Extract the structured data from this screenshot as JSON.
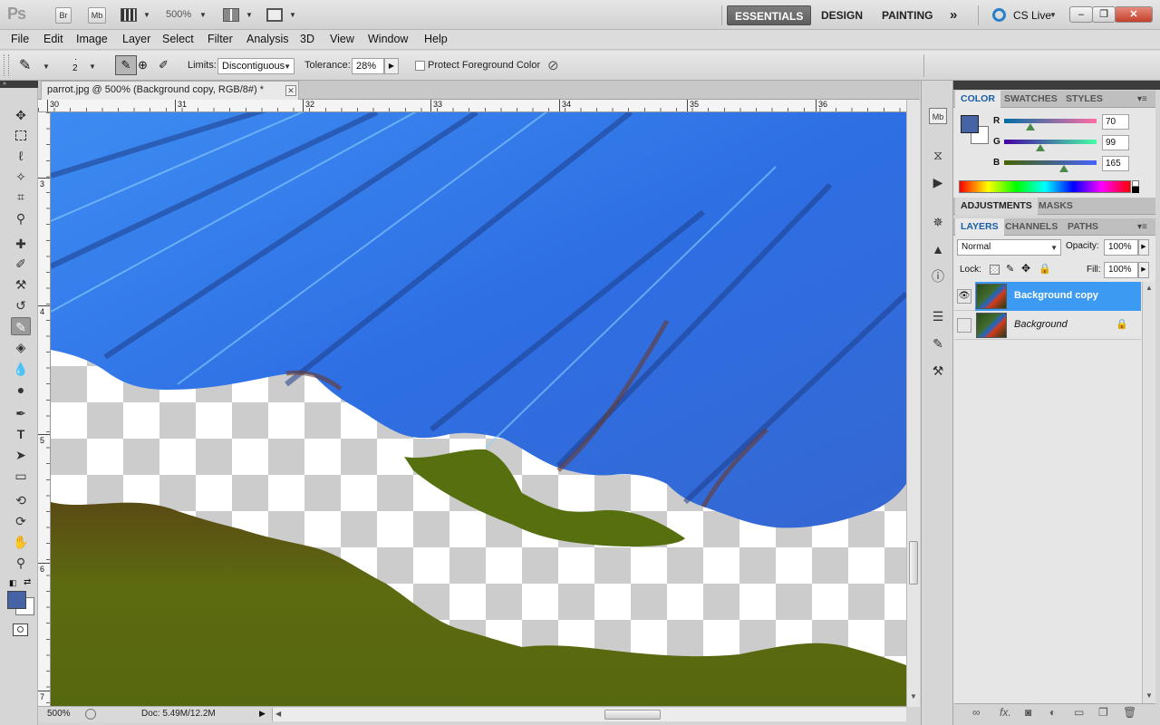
{
  "appbar": {
    "logo": "Ps",
    "bridge_btn": "Br",
    "minibridge_btn": "Mb",
    "zoom": "500%",
    "workspaces": [
      "ESSENTIALS",
      "DESIGN",
      "PAINTING"
    ],
    "more_workspaces": "»",
    "cs_live": "CS Live",
    "window_buttons": {
      "minimize": "–",
      "restore": "❐",
      "close": "✕"
    }
  },
  "menubar": [
    "File",
    "Edit",
    "Image",
    "Layer",
    "Select",
    "Filter",
    "Analysis",
    "3D",
    "View",
    "Window",
    "Help"
  ],
  "options": {
    "brush_size": "2",
    "limits_label": "Limits:",
    "limits_value": "Discontiguous",
    "tolerance_label": "Tolerance:",
    "tolerance_value": "28%",
    "protect_label": "Protect Foreground Color"
  },
  "document": {
    "tab_title": "parrot.jpg @ 500% (Background copy, RGB/8#) *",
    "ruler_h": [
      "30",
      "31",
      "32",
      "33",
      "34",
      "35",
      "36"
    ],
    "ruler_v": [
      "3",
      "4",
      "5",
      "6",
      "7"
    ],
    "status_zoom": "500%",
    "status_doc": "Doc: 5.49M/12.2M"
  },
  "colors": {
    "foreground": "#4663a5",
    "background": "#ffffff",
    "wing_blue": "#2f6fe0",
    "grass_green": "#5b6a10",
    "layer_selected": "#3d9af2"
  },
  "color_panel": {
    "tabs": [
      "COLOR",
      "SWATCHES",
      "STYLES"
    ],
    "r_label": "R",
    "g_label": "G",
    "b_label": "B",
    "r": "70",
    "g": "99",
    "b": "165"
  },
  "adjustments_panel": {
    "tabs": [
      "ADJUSTMENTS",
      "MASKS"
    ]
  },
  "layers_panel": {
    "tabs": [
      "LAYERS",
      "CHANNELS",
      "PATHS"
    ],
    "blend_mode": "Normal",
    "opacity_label": "Opacity:",
    "opacity": "100%",
    "lock_label": "Lock:",
    "fill_label": "Fill:",
    "fill": "100%",
    "layers": [
      {
        "name": "Background copy",
        "visible": true,
        "selected": true
      },
      {
        "name": "Background",
        "visible": false,
        "selected": false,
        "locked": true
      }
    ]
  }
}
